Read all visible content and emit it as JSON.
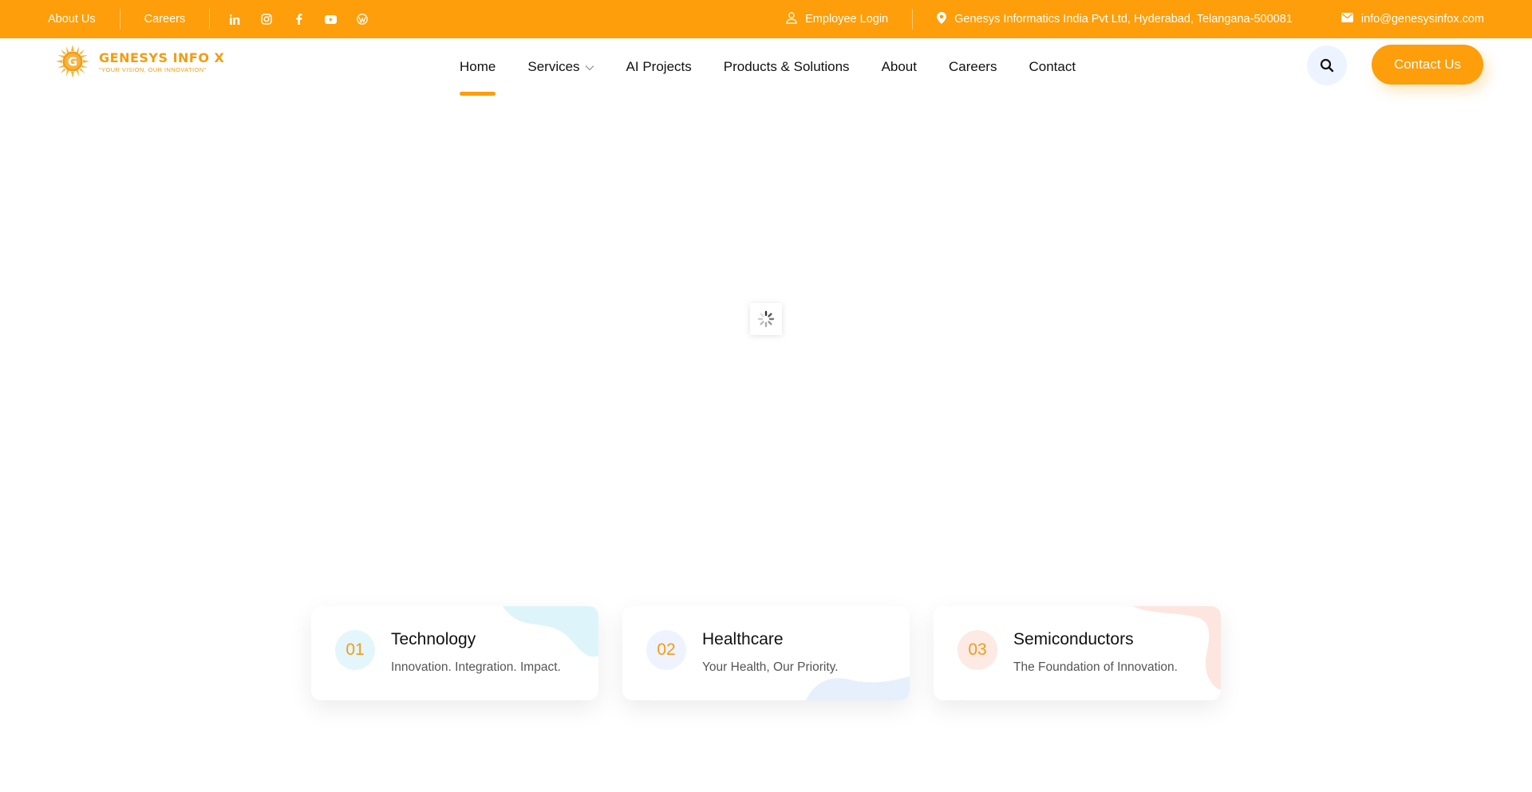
{
  "topbar": {
    "about_us": "About Us",
    "careers": "Careers",
    "social_icons": [
      "linkedin-icon",
      "instagram-icon",
      "facebook-icon",
      "youtube-icon",
      "wordpress-icon"
    ],
    "employee_login": "Employee Login",
    "address": "Genesys Informatics India Pvt Ltd, Hyderabad, Telangana-500081",
    "email": "info@genesysinfox.com"
  },
  "header": {
    "logo_title": "GENESYS INFO X",
    "logo_tagline": "\"YOUR VISION, OUR INNOVATION\"",
    "logo_letter": "G",
    "nav": [
      "Home",
      "Services",
      "AI Projects",
      "Products & Solutions",
      "About",
      "Careers",
      "Contact"
    ],
    "active_nav": "Home",
    "contact_button": "Contact Us"
  },
  "cards": [
    {
      "num": "01",
      "title": "Technology",
      "subtitle": "Innovation. Integration. Impact.",
      "num_bg": "#e3f6fb",
      "blob_color": "#def4fb"
    },
    {
      "num": "02",
      "title": "Healthcare",
      "subtitle": "Your Health, Our Priority.",
      "num_bg": "#eef3ff",
      "blob_color": "#e6f0fd"
    },
    {
      "num": "03",
      "title": "Semiconductors",
      "subtitle": "The Foundation of Innovation.",
      "num_bg": "#fdeae5",
      "blob_color": "#fde6df"
    }
  ],
  "colors": {
    "accent": "#fd9e0a",
    "text": "#111111"
  }
}
